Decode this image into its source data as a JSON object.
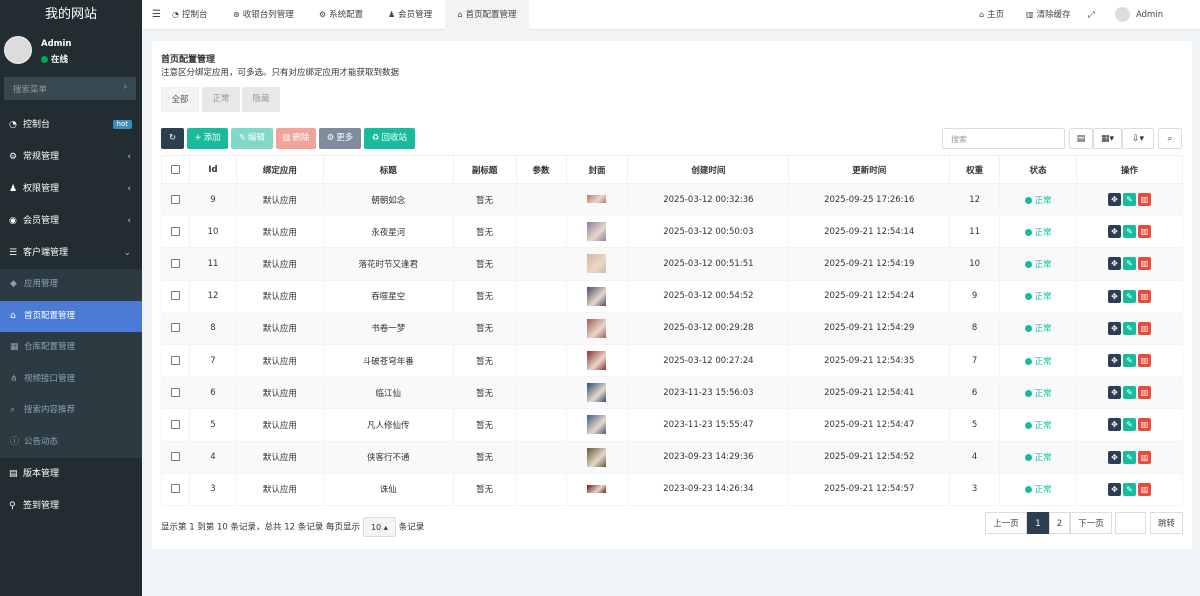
{
  "sidebar": {
    "logo": "我的网站",
    "user": {
      "name": "Admin",
      "status": "在线"
    },
    "search_placeholder": "搜索菜单",
    "items": [
      {
        "icon": "dashboard-icon",
        "glyph": "◔",
        "label": "控制台",
        "badge": "hot"
      },
      {
        "icon": "cogs-icon",
        "glyph": "⚙",
        "label": "常规管理",
        "arrow": "‹"
      },
      {
        "icon": "group-icon",
        "glyph": "♟",
        "label": "权限管理",
        "arrow": "‹"
      },
      {
        "icon": "user-circle-icon",
        "glyph": "◉",
        "label": "会员管理",
        "arrow": "‹"
      },
      {
        "icon": "list-icon",
        "glyph": "☰",
        "label": "客户端管理",
        "arrow": "⌄"
      }
    ],
    "subitems": [
      {
        "icon": "diamond-icon",
        "glyph": "◆",
        "label": "应用管理"
      },
      {
        "icon": "home-icon",
        "glyph": "⌂",
        "label": "首页配置管理",
        "active": true
      },
      {
        "icon": "bank-icon",
        "glyph": "▦",
        "label": "仓库配置管理"
      },
      {
        "icon": "sitemap-icon",
        "glyph": "⋔",
        "label": "视频接口管理"
      },
      {
        "icon": "search-icon",
        "glyph": "⌕",
        "label": "搜索内容推荐"
      },
      {
        "icon": "info-icon",
        "glyph": "ⓘ",
        "label": "公告动态"
      }
    ],
    "bottom_items": [
      {
        "icon": "file-icon",
        "glyph": "▤",
        "label": "版本管理"
      },
      {
        "icon": "map-marker-icon",
        "glyph": "⚲",
        "label": "签到管理"
      }
    ]
  },
  "topbar": {
    "tabs": [
      {
        "label": "控制台",
        "glyph": "◔"
      },
      {
        "label": "收银台列管理",
        "glyph": "⊛"
      },
      {
        "label": "系统配置",
        "glyph": "⚙"
      },
      {
        "label": "会员管理",
        "glyph": "♟"
      },
      {
        "label": "首页配置管理",
        "glyph": "⌂"
      }
    ],
    "home": "主页",
    "clear_cache": "清除缓存",
    "admin": "Admin"
  },
  "page": {
    "title": "首页配置管理",
    "description": "注意区分绑定应用，可多选。只有对应绑定应用才能获取到数据",
    "tabs": [
      "全部",
      "正常",
      "隐藏"
    ]
  },
  "toolbar": {
    "add": "添加",
    "edit": "编辑",
    "delete": "删除",
    "more": "更多",
    "recycle": "回收站",
    "search_placeholder": "搜索"
  },
  "table": {
    "headers": [
      "Id",
      "绑定应用",
      "标题",
      "副标题",
      "参数",
      "封面",
      "创建时间",
      "更新时间",
      "权重",
      "状态",
      "操作"
    ],
    "rows": [
      {
        "id": "9",
        "app": "默认应用",
        "title": "朝朝如念",
        "subtitle": "暂无",
        "param": "",
        "created": "2025-03-12 00:32:36",
        "updated": "2025-09-25 17:26:16",
        "weight": "12",
        "status": "正常",
        "cover": "#b77a6a"
      },
      {
        "id": "10",
        "app": "默认应用",
        "title": "永夜星河",
        "subtitle": "暂无",
        "param": "",
        "created": "2025-03-12 00:50:03",
        "updated": "2025-09-21 12:54:14",
        "weight": "11",
        "status": "正常",
        "cover": "#8a7ea0"
      },
      {
        "id": "11",
        "app": "默认应用",
        "title": "落花时节又逢君",
        "subtitle": "暂无",
        "param": "",
        "created": "2025-03-12 00:51:51",
        "updated": "2025-09-21 12:54:19",
        "weight": "10",
        "status": "正常",
        "cover": "#d7b7a4"
      },
      {
        "id": "12",
        "app": "默认应用",
        "title": "吞噬星空",
        "subtitle": "暂无",
        "param": "",
        "created": "2025-03-12 00:54:52",
        "updated": "2025-09-21 12:54:24",
        "weight": "9",
        "status": "正常",
        "cover": "#4a4a6a"
      },
      {
        "id": "8",
        "app": "默认应用",
        "title": "书卷一梦",
        "subtitle": "暂无",
        "param": "",
        "created": "2025-03-12 00:29:28",
        "updated": "2025-09-21 12:54:29",
        "weight": "8",
        "status": "正常",
        "cover": "#a05a5a"
      },
      {
        "id": "7",
        "app": "默认应用",
        "title": "斗破苍穹年番",
        "subtitle": "暂无",
        "param": "",
        "created": "2025-03-12 00:27:24",
        "updated": "2025-09-21 12:54:35",
        "weight": "7",
        "status": "正常",
        "cover": "#8a2a3a"
      },
      {
        "id": "6",
        "app": "默认应用",
        "title": "临江仙",
        "subtitle": "暂无",
        "param": "",
        "created": "2023-11-23 15:56:03",
        "updated": "2025-09-21 12:54:41",
        "weight": "6",
        "status": "正常",
        "cover": "#2a4a7a"
      },
      {
        "id": "5",
        "app": "默认应用",
        "title": "凡人修仙传",
        "subtitle": "暂无",
        "param": "",
        "created": "2023-11-23 15:55:47",
        "updated": "2025-09-21 12:54:47",
        "weight": "5",
        "status": "正常",
        "cover": "#3a5a8a"
      },
      {
        "id": "4",
        "app": "默认应用",
        "title": "侠客行不通",
        "subtitle": "暂无",
        "param": "",
        "created": "2023-09-23 14:29:36",
        "updated": "2025-09-21 12:54:52",
        "weight": "4",
        "status": "正常",
        "cover": "#5a5a3a"
      },
      {
        "id": "3",
        "app": "默认应用",
        "title": "诛仙",
        "subtitle": "暂无",
        "param": "",
        "created": "2023-09-23 14:26:34",
        "updated": "2025-09-21 12:54:57",
        "weight": "3",
        "status": "正常",
        "cover": "#6a1a1a"
      }
    ]
  },
  "footer": {
    "info": "显示第 1 到第 10 条记录，总共 12 条记录 每页显示",
    "page_size": "10",
    "suffix": "条记录",
    "prev": "上一页",
    "pages": [
      "1",
      "2"
    ],
    "next": "下一页",
    "goto": "跳转"
  },
  "colors": {
    "sidebar_bg": "#222d32",
    "active_menu": "#4a7cd6",
    "success": "#18bc9c",
    "danger": "#e74c3c",
    "dark": "#2c3e50"
  }
}
